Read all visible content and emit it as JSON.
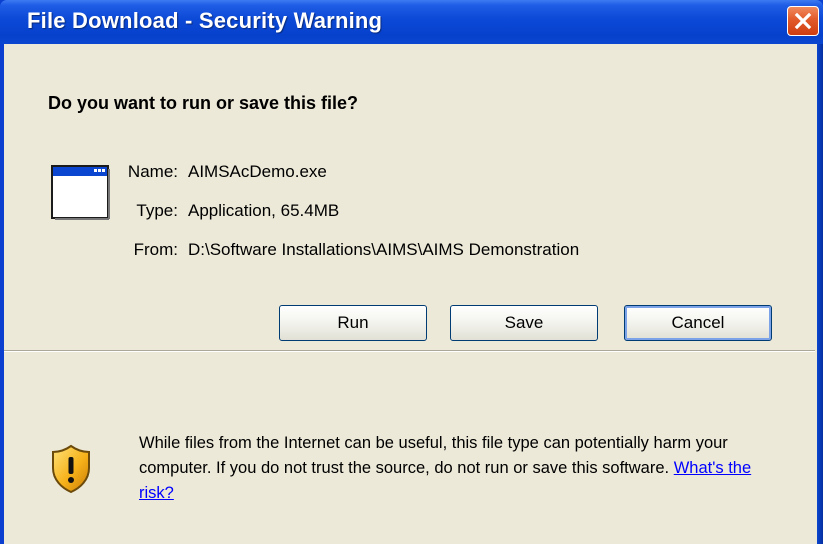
{
  "window": {
    "title": "File Download - Security Warning",
    "close_icon": "close-icon"
  },
  "dialog": {
    "question": "Do you want to run or save this file?",
    "file_icon": "application-window-icon",
    "fields": {
      "name_label": "Name:",
      "name_value": "AIMSAcDemo.exe",
      "type_label": "Type:",
      "type_value": "Application, 65.4MB",
      "from_label": "From:",
      "from_value": "D:\\Software Installations\\AIMS\\AIMS Demonstration"
    },
    "buttons": {
      "run": "Run",
      "save": "Save",
      "cancel": "Cancel"
    },
    "warning_icon": "shield-warning-icon",
    "warning_text": "While files from the Internet can be useful, this file type can potentially harm your computer. If you do not trust the source, do not run or save this software.",
    "risk_link": "What's the risk?"
  },
  "colors": {
    "titlebar": "#0a46cf",
    "client_bg": "#ece9d8",
    "close_button": "#e25a2a",
    "link": "#0000ff",
    "default_button_focus": "#7ca2e8"
  }
}
